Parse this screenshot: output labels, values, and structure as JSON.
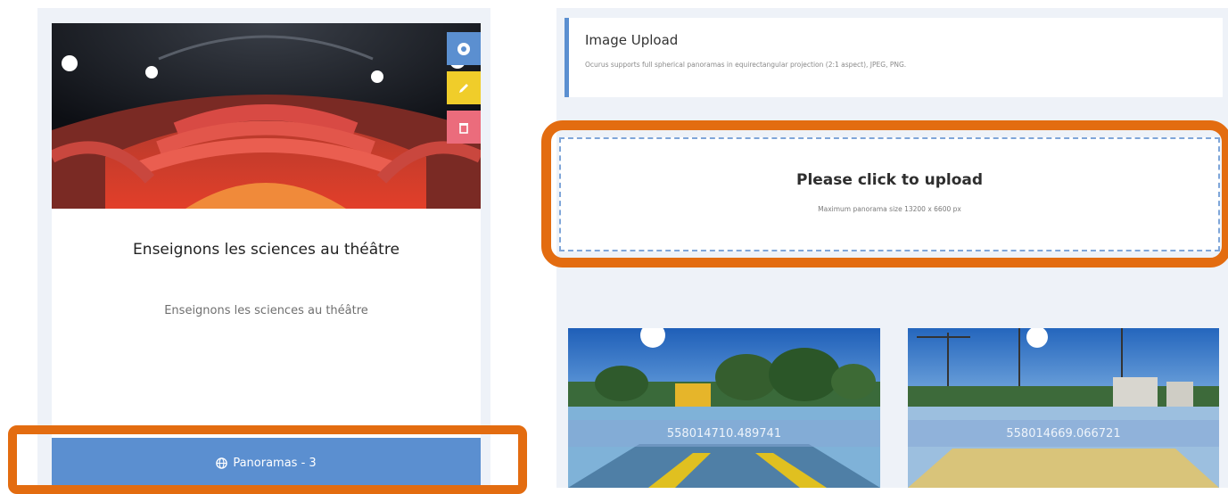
{
  "project": {
    "title": "Enseignons les sciences au théâtre",
    "description": "Enseignons les sciences au théâtre",
    "panoramas_button_label": "Panoramas - 3",
    "actions": [
      "view-icon",
      "pencil-icon",
      "trash-icon"
    ]
  },
  "upload": {
    "section_title": "Image Upload",
    "section_text": "Ocurus supports full spherical panoramas in equirectangular projection (2:1 aspect), JPEG, PNG.",
    "dropzone_title": "Please click to upload",
    "dropzone_subtitle": "Maximum panorama size 13200 x 6600 px"
  },
  "panoramas": [
    {
      "label": "558014710.489741"
    },
    {
      "label": "558014669.066721"
    }
  ],
  "colors": {
    "accent_blue": "#5b8fd0",
    "edit_yellow": "#f0cd2a",
    "delete_pink": "#eb6c7c",
    "highlight_orange": "#e36c10",
    "panel_bg": "#eef2f8"
  }
}
